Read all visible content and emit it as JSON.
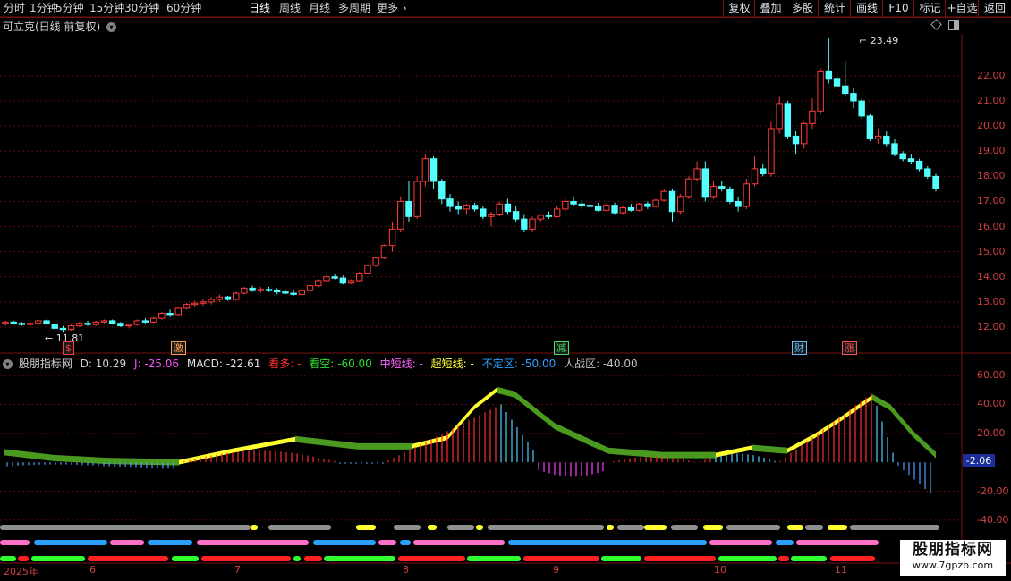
{
  "toolbar": {
    "periods": [
      "分时",
      "1分钟",
      "5分钟",
      "15分钟",
      "30分钟",
      "60分钟",
      "日线",
      "周线",
      "月线",
      "多周期",
      "更多"
    ],
    "active_period": "日线",
    "more_chevron": "›",
    "right_buttons": [
      "复权",
      "叠加",
      "多股",
      "统计",
      "画线",
      "F10",
      "标记",
      "+自选",
      "返回"
    ]
  },
  "main": {
    "title": "可立克(日线 前复权)",
    "high_label": "23.49",
    "low_label": "11.81",
    "price_axis": [
      "22.00",
      "21.00",
      "20.00",
      "19.00",
      "18.00",
      "17.00",
      "16.00",
      "15.00",
      "14.00",
      "13.00",
      "12.00"
    ],
    "markers": [
      {
        "text": "$",
        "color": "#ff4040"
      },
      {
        "text": "激",
        "color": "#ffa050"
      },
      {
        "text": "减",
        "color": "#40e060"
      },
      {
        "text": "财",
        "color": "#60c0ff"
      },
      {
        "text": "涨",
        "color": "#ff5050"
      }
    ]
  },
  "indicator": {
    "name": "股朋指标网",
    "d": "D: 10.29",
    "j": "J: -25.06",
    "macd": "MACD: -22.61",
    "kanduo": "看多: -",
    "kankong": "看空: -60.00",
    "zhongduan": "中短线: -",
    "chaoduan": "超短线: -",
    "buding": "不定区: -50.00",
    "renzhan": "人战区: -40.00",
    "axis": [
      "60.00",
      "40.00",
      "20.00",
      "-20.00",
      "-40.00"
    ],
    "current_value": "-2.06",
    "colors": {
      "kanduo": "#ff3030",
      "kankong": "#30e030",
      "zhongduan": "#ff60ff",
      "chaoduan": "#ffff30",
      "buding": "#30a0ff",
      "renzhan": "#c0c0c0"
    }
  },
  "dates": [
    "2025年",
    "6",
    "7",
    "8",
    "9",
    "10",
    "11"
  ],
  "watermark": {
    "title": "股朋指标网",
    "url": "www.7gpzb.com"
  },
  "chart_data": {
    "type": "candlestick",
    "title": "可立克(日线 前复权)",
    "y_range": [
      11.5,
      23.6
    ],
    "annotations": {
      "high": 23.49,
      "low": 11.81
    },
    "ohlc": [
      [
        12.15,
        12.25,
        12.05,
        12.2
      ],
      [
        12.2,
        12.25,
        12.1,
        12.15
      ],
      [
        12.15,
        12.2,
        12.05,
        12.1
      ],
      [
        12.1,
        12.2,
        12.0,
        12.15
      ],
      [
        12.15,
        12.3,
        12.1,
        12.25
      ],
      [
        12.25,
        12.3,
        12.1,
        12.12
      ],
      [
        12.1,
        12.15,
        11.9,
        11.95
      ],
      [
        11.95,
        12.05,
        11.81,
        11.9
      ],
      [
        11.9,
        12.1,
        11.85,
        12.05
      ],
      [
        12.05,
        12.2,
        12.0,
        12.15
      ],
      [
        12.15,
        12.25,
        12.05,
        12.1
      ],
      [
        12.1,
        12.25,
        12.05,
        12.2
      ],
      [
        12.2,
        12.3,
        12.15,
        12.25
      ],
      [
        12.25,
        12.3,
        12.1,
        12.15
      ],
      [
        12.15,
        12.2,
        12.0,
        12.05
      ],
      [
        12.05,
        12.15,
        11.95,
        12.1
      ],
      [
        12.1,
        12.3,
        12.05,
        12.25
      ],
      [
        12.25,
        12.35,
        12.15,
        12.2
      ],
      [
        12.2,
        12.4,
        12.15,
        12.35
      ],
      [
        12.35,
        12.6,
        12.3,
        12.55
      ],
      [
        12.55,
        12.7,
        12.4,
        12.5
      ],
      [
        12.5,
        12.8,
        12.45,
        12.75
      ],
      [
        12.75,
        12.95,
        12.7,
        12.9
      ],
      [
        12.9,
        13.05,
        12.8,
        12.95
      ],
      [
        12.95,
        13.1,
        12.85,
        13.0
      ],
      [
        13.0,
        13.2,
        12.9,
        13.1
      ],
      [
        13.1,
        13.3,
        13.0,
        13.2
      ],
      [
        13.2,
        13.25,
        13.05,
        13.1
      ],
      [
        13.1,
        13.4,
        13.05,
        13.35
      ],
      [
        13.35,
        13.6,
        13.3,
        13.55
      ],
      [
        13.55,
        13.65,
        13.4,
        13.45
      ],
      [
        13.45,
        13.6,
        13.35,
        13.5
      ],
      [
        13.5,
        13.6,
        13.4,
        13.45
      ],
      [
        13.45,
        13.55,
        13.3,
        13.4
      ],
      [
        13.4,
        13.5,
        13.3,
        13.35
      ],
      [
        13.35,
        13.45,
        13.25,
        13.3
      ],
      [
        13.3,
        13.5,
        13.25,
        13.45
      ],
      [
        13.45,
        13.7,
        13.4,
        13.65
      ],
      [
        13.65,
        13.9,
        13.6,
        13.85
      ],
      [
        13.85,
        14.05,
        13.8,
        14.0
      ],
      [
        14.0,
        14.1,
        13.9,
        13.95
      ],
      [
        13.95,
        14.05,
        13.7,
        13.75
      ],
      [
        13.75,
        13.9,
        13.7,
        13.85
      ],
      [
        13.85,
        14.2,
        13.8,
        14.15
      ],
      [
        14.15,
        14.5,
        14.1,
        14.45
      ],
      [
        14.45,
        14.8,
        14.4,
        14.75
      ],
      [
        14.75,
        15.3,
        14.7,
        15.25
      ],
      [
        15.25,
        16.2,
        15.0,
        15.9
      ],
      [
        15.9,
        17.2,
        15.8,
        17.0
      ],
      [
        17.0,
        17.8,
        16.2,
        16.4
      ],
      [
        16.4,
        18.0,
        16.3,
        17.8
      ],
      [
        17.8,
        18.9,
        17.6,
        18.7
      ],
      [
        18.7,
        18.8,
        17.5,
        17.8
      ],
      [
        17.8,
        17.9,
        16.9,
        17.1
      ],
      [
        17.1,
        17.3,
        16.6,
        16.8
      ],
      [
        16.8,
        17.0,
        16.5,
        16.7
      ],
      [
        16.7,
        16.9,
        16.5,
        16.85
      ],
      [
        16.85,
        16.95,
        16.6,
        16.7
      ],
      [
        16.7,
        16.8,
        16.3,
        16.4
      ],
      [
        16.4,
        16.6,
        16.0,
        16.5
      ],
      [
        16.5,
        17.0,
        16.4,
        16.9
      ],
      [
        16.9,
        17.1,
        16.5,
        16.6
      ],
      [
        16.6,
        16.8,
        16.2,
        16.3
      ],
      [
        16.3,
        16.5,
        15.8,
        15.9
      ],
      [
        15.9,
        16.4,
        15.8,
        16.3
      ],
      [
        16.3,
        16.5,
        16.2,
        16.45
      ],
      [
        16.45,
        16.6,
        16.3,
        16.4
      ],
      [
        16.4,
        16.8,
        16.35,
        16.7
      ],
      [
        16.7,
        17.1,
        16.6,
        17.0
      ],
      [
        17.0,
        17.2,
        16.8,
        16.9
      ],
      [
        16.9,
        17.05,
        16.7,
        16.85
      ],
      [
        16.85,
        17.0,
        16.7,
        16.8
      ],
      [
        16.8,
        16.95,
        16.6,
        16.65
      ],
      [
        16.65,
        16.9,
        16.6,
        16.85
      ],
      [
        16.85,
        16.95,
        16.5,
        16.55
      ],
      [
        16.55,
        16.8,
        16.5,
        16.75
      ],
      [
        16.75,
        16.9,
        16.6,
        16.65
      ],
      [
        16.65,
        16.95,
        16.6,
        16.9
      ],
      [
        16.9,
        17.0,
        16.7,
        16.8
      ],
      [
        16.8,
        17.1,
        16.75,
        17.05
      ],
      [
        17.05,
        17.5,
        17.0,
        17.4
      ],
      [
        17.4,
        17.5,
        16.2,
        16.6
      ],
      [
        16.6,
        17.3,
        16.5,
        17.2
      ],
      [
        17.2,
        18.0,
        17.1,
        17.9
      ],
      [
        17.9,
        18.6,
        17.8,
        18.3
      ],
      [
        18.3,
        18.6,
        17.0,
        17.2
      ],
      [
        17.2,
        17.8,
        17.1,
        17.6
      ],
      [
        17.6,
        17.8,
        17.4,
        17.5
      ],
      [
        17.5,
        17.6,
        16.9,
        17.0
      ],
      [
        17.0,
        17.2,
        16.6,
        16.8
      ],
      [
        16.8,
        17.9,
        16.7,
        17.7
      ],
      [
        17.7,
        18.8,
        17.6,
        18.3
      ],
      [
        18.3,
        18.5,
        18.0,
        18.1
      ],
      [
        18.1,
        20.2,
        18.0,
        19.9
      ],
      [
        19.9,
        21.2,
        19.7,
        20.9
      ],
      [
        20.9,
        21.0,
        19.5,
        19.6
      ],
      [
        19.6,
        19.8,
        18.9,
        19.3
      ],
      [
        19.3,
        20.2,
        19.1,
        20.1
      ],
      [
        20.1,
        21.1,
        19.9,
        20.6
      ],
      [
        20.6,
        22.3,
        20.5,
        22.2
      ],
      [
        22.2,
        23.49,
        21.7,
        21.9
      ],
      [
        21.9,
        22.1,
        21.4,
        21.6
      ],
      [
        21.6,
        22.6,
        21.2,
        21.3
      ],
      [
        21.3,
        21.5,
        20.7,
        21.0
      ],
      [
        21.0,
        21.1,
        20.3,
        20.4
      ],
      [
        20.4,
        20.5,
        19.4,
        19.5
      ],
      [
        19.5,
        19.9,
        19.3,
        19.6
      ],
      [
        19.6,
        19.8,
        19.2,
        19.3
      ],
      [
        19.3,
        19.5,
        18.8,
        18.9
      ],
      [
        18.9,
        19.0,
        18.6,
        18.7
      ],
      [
        18.7,
        18.9,
        18.5,
        18.6
      ],
      [
        18.6,
        18.7,
        18.2,
        18.3
      ],
      [
        18.3,
        18.4,
        17.9,
        18.0
      ],
      [
        18.0,
        18.1,
        17.4,
        17.5
      ]
    ],
    "indicator_range": [
      -45,
      65
    ],
    "indicator_axis": [
      60,
      40,
      20,
      -20,
      -40
    ],
    "indicator_current": -2.06
  }
}
